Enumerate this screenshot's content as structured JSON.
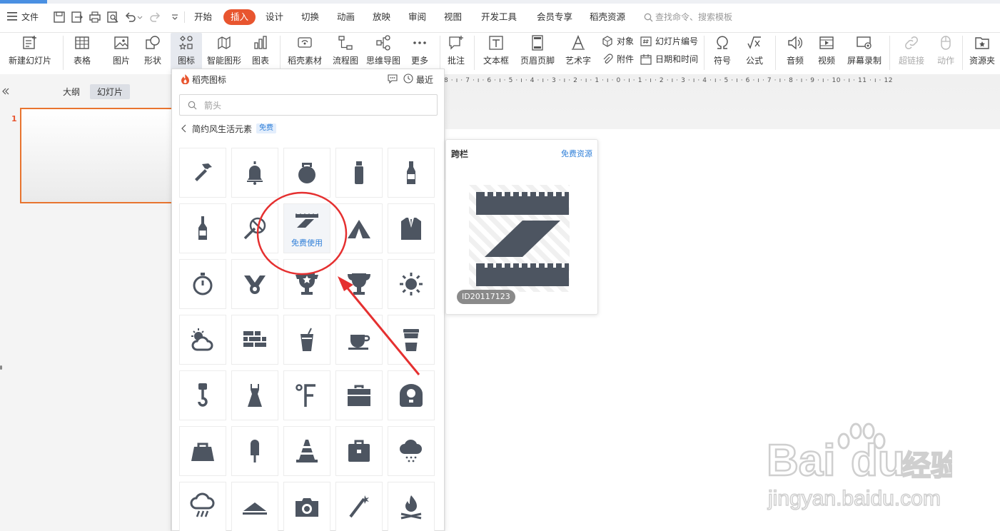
{
  "menubar": {
    "file_label": "文件",
    "tabs": [
      "开始",
      "插入",
      "设计",
      "切换",
      "动画",
      "放映",
      "审阅",
      "视图",
      "开发工具",
      "会员专享",
      "稻壳资源"
    ],
    "active_tab": "插入",
    "search_placeholder": "查找命令、搜索模板"
  },
  "ribbon": {
    "new_slide": "新建幻灯片",
    "table": "表格",
    "picture": "图片",
    "shape": "形状",
    "icon": "图标",
    "smart_art": "智能图形",
    "chart": "图表",
    "daoke_material": "稻壳素材",
    "flowchart": "流程图",
    "mindmap": "思维导图",
    "more": "更多",
    "comment": "批注",
    "textbox": "文本框",
    "header_footer": "页眉页脚",
    "wordart": "艺术字",
    "object": "对象",
    "attachment": "附件",
    "slide_number": "幻灯片编号",
    "date_time": "日期和时间",
    "symbol": "符号",
    "formula": "公式",
    "audio": "音频",
    "video": "视频",
    "screen_record": "屏幕录制",
    "hyperlink": "超链接",
    "action": "动作",
    "resource_folder": "资源夹"
  },
  "left_panel": {
    "outline_tab": "大纲",
    "slides_tab": "幻灯片",
    "slide_number": "1"
  },
  "ruler_text": "8 · ı · 7 · ı · 6 · ı · 5 · ı · 4 · ı · 3 · ı · 2 · ı · 1 · ı · 0 · ı · 1 · ı · 2 · ı · 3 · ı · 4 · ı · 5 · ı · 6 · ı · 7 · ı · 8 · ı · 9 · ı · 10 · ı · 11 · ı · 12",
  "icon_panel": {
    "title": "稻壳图标",
    "recent_label": "最近",
    "search_value": "箭头",
    "breadcrumb": "简约风生活元素",
    "free_badge": "免费",
    "free_use_label": "免费使用",
    "icons": [
      "hammer-icon",
      "bell-icon",
      "kettlebell-icon",
      "water-bottle-icon",
      "beer-bottle-icon",
      "wine-bottle-icon",
      "no-smoking-icon",
      "hurdle-icon",
      "tent-icon",
      "suit-icon",
      "stopwatch-icon",
      "medal-icon",
      "trophy-star-icon",
      "trophy-icon",
      "sun-icon",
      "partly-cloudy-icon",
      "brick-wall-icon",
      "drink-icon",
      "coffee-cup-icon",
      "takeaway-cup-icon",
      "crane-hook-icon",
      "dress-icon",
      "fahrenheit-icon",
      "toolbox-icon",
      "rice-cooker-icon",
      "handbag-icon",
      "popsicle-icon",
      "traffic-cone-icon",
      "briefcase-icon",
      "cloud-snow-icon",
      "cloud-rain-icon",
      "tray-icon",
      "camera-icon",
      "firework-icon",
      "campfire-icon"
    ]
  },
  "preview": {
    "title": "跨栏",
    "free_resource": "免费资源",
    "id_label": "ID20117123"
  },
  "colors": {
    "accent": "#e8552f",
    "link": "#2f7fd8",
    "icon_fill": "#4d5561",
    "annotation": "#e53030"
  }
}
